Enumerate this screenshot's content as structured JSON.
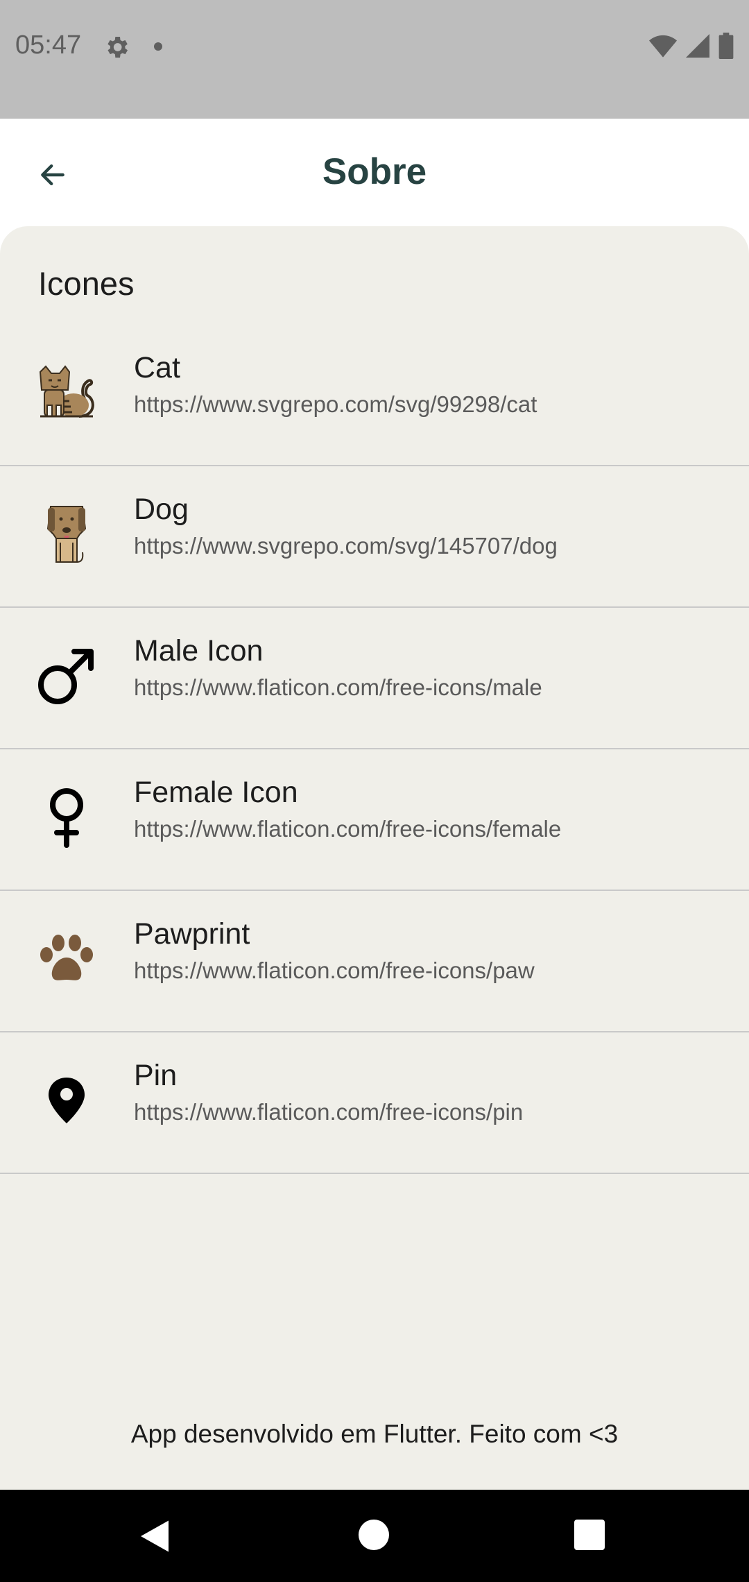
{
  "status_bar": {
    "time": "05:47",
    "icons": [
      "gear-icon",
      "dot-icon",
      "wifi-icon",
      "signal-icon",
      "battery-icon"
    ]
  },
  "app_bar": {
    "title": "Sobre",
    "back_icon": "arrow-back-icon"
  },
  "section": {
    "title": "Icones"
  },
  "items": [
    {
      "icon": "cat-icon",
      "title": "Cat",
      "url": "https://www.svgrepo.com/svg/99298/cat"
    },
    {
      "icon": "dog-icon",
      "title": "Dog",
      "url": "https://www.svgrepo.com/svg/145707/dog"
    },
    {
      "icon": "male-icon",
      "title": "Male Icon",
      "url": "https://www.flaticon.com/free-icons/male"
    },
    {
      "icon": "female-icon",
      "title": "Female Icon",
      "url": "https://www.flaticon.com/free-icons/female"
    },
    {
      "icon": "pawprint-icon",
      "title": "Pawprint",
      "url": "https://www.flaticon.com/free-icons/paw"
    },
    {
      "icon": "pin-icon",
      "title": "Pin",
      "url": "https://www.flaticon.com/free-icons/pin"
    }
  ],
  "footer": {
    "text": "App desenvolvido em Flutter. Feito com <3"
  },
  "colors": {
    "title": "#274342",
    "background": "#f0efe9",
    "status_bar": "#bdbdbd"
  }
}
